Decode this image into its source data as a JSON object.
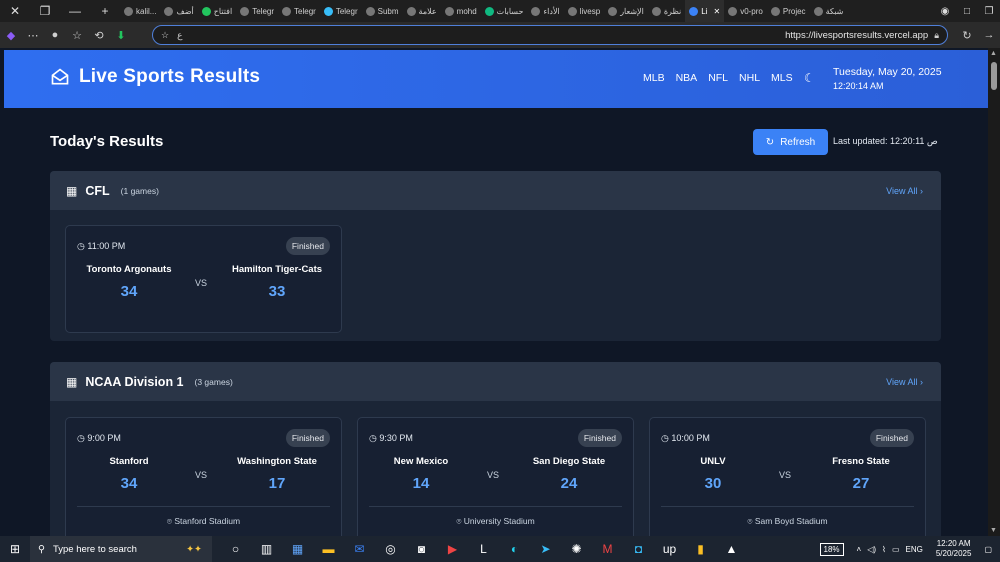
{
  "browser": {
    "tabs": [
      {
        "label": "kalil..."
      },
      {
        "label": "أضف"
      },
      {
        "label": "افتتاح"
      },
      {
        "label": "Telegr"
      },
      {
        "label": "Telegr"
      },
      {
        "label": "Telegr"
      },
      {
        "label": "Subm"
      },
      {
        "label": "علامة"
      },
      {
        "label": "mohd"
      },
      {
        "label": "حسابات"
      },
      {
        "label": "الأداء"
      },
      {
        "label": "livesp"
      },
      {
        "label": "الإشعار"
      },
      {
        "label": "نظرة"
      },
      {
        "label": "Li"
      },
      {
        "label": "v0-pro"
      },
      {
        "label": "Projec"
      },
      {
        "label": "شبكة"
      }
    ],
    "address_placeholder": "ع",
    "url": "https://livesportsresults.vercel.app"
  },
  "header": {
    "title": "Live Sports Results",
    "nav": [
      "MLB",
      "NBA",
      "NFL",
      "NHL",
      "MLS"
    ],
    "date": "Tuesday, May 20, 2025",
    "time": "12:20:14 AM"
  },
  "toolbar": {
    "title": "Today's Results",
    "refresh_label": "Refresh",
    "last_updated": "Last updated: 12:20:11 ص"
  },
  "leagues": [
    {
      "name": "CFL",
      "count": "(1 games)",
      "view_all": "View All",
      "games": [
        {
          "time": "11:00 PM",
          "status": "Finished",
          "home": "Toronto Argonauts",
          "away": "Hamilton Tiger-Cats",
          "home_score": "34",
          "away_score": "33",
          "vs": "VS"
        }
      ]
    },
    {
      "name": "NCAA Division 1",
      "count": "(3 games)",
      "view_all": "View All",
      "games": [
        {
          "time": "9:00 PM",
          "status": "Finished",
          "home": "Stanford",
          "away": "Washington State",
          "home_score": "34",
          "away_score": "17",
          "vs": "VS",
          "venue": "Stanford Stadium"
        },
        {
          "time": "9:30 PM",
          "status": "Finished",
          "home": "New Mexico",
          "away": "San Diego State",
          "home_score": "14",
          "away_score": "24",
          "vs": "VS",
          "venue": "University Stadium"
        },
        {
          "time": "10:00 PM",
          "status": "Finished",
          "home": "UNLV",
          "away": "Fresno State",
          "home_score": "30",
          "away_score": "27",
          "vs": "VS",
          "venue": "Sam Boyd Stadium"
        }
      ]
    }
  ],
  "taskbar": {
    "search_placeholder": "Type here to search",
    "battery": "18%",
    "lang": "ENG",
    "clock_time": "12:20 AM",
    "clock_date": "5/20/2025"
  },
  "colors": {
    "header_blue": "#2f6ef0",
    "accent_blue": "#3b82f6",
    "score_blue": "#60a5fa",
    "page_bg": "#0f1726"
  }
}
